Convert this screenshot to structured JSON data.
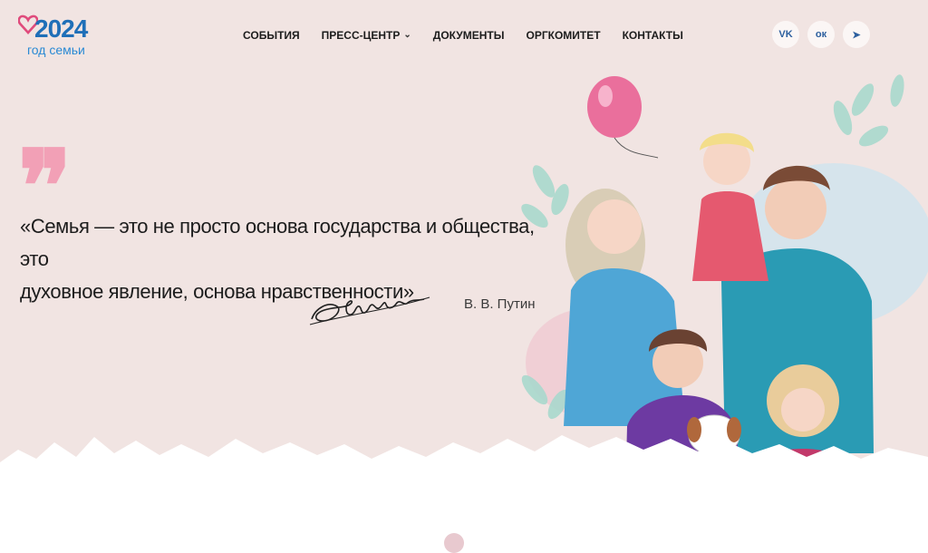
{
  "logo": {
    "year": "2024",
    "subtitle": "год семьи"
  },
  "nav": {
    "items": [
      {
        "label": "СОБЫТИЯ"
      },
      {
        "label": "ПРЕСС-ЦЕНТР",
        "dropdown": true
      },
      {
        "label": "ДОКУМЕНТЫ"
      },
      {
        "label": "ОРГКОМИТЕТ"
      },
      {
        "label": "КОНТАКТЫ"
      }
    ]
  },
  "socials": [
    {
      "icon": "vk-icon",
      "label": "VK"
    },
    {
      "icon": "odnoklassniki-icon",
      "label": "ок"
    },
    {
      "icon": "telegram-icon",
      "label": "➤"
    }
  ],
  "quote": {
    "mark": "❞",
    "line1": "«Семья — это не просто основа государства и общества, это",
    "line2": "духовное явление, основа нравственности»",
    "author": "В. В. Путин"
  },
  "colors": {
    "background": "#f1e4e2",
    "accent_pink": "#f2a0b6",
    "brand_blue": "#1f6fb8"
  }
}
